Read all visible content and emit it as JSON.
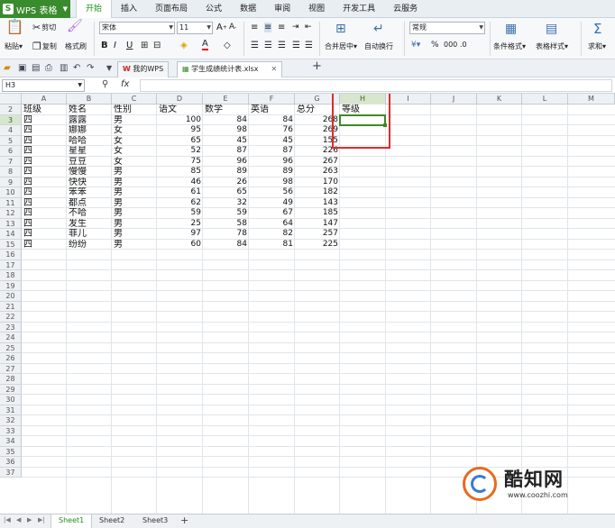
{
  "menubar": {
    "app_name": "WPS 表格",
    "tabs": [
      "开始",
      "插入",
      "页面布局",
      "公式",
      "数据",
      "审阅",
      "视图",
      "开发工具",
      "云服务"
    ],
    "active_tab": 0
  },
  "ribbon": {
    "paste": "粘贴",
    "cut": "剪切",
    "copy": "复制",
    "format_painter": "格式刷",
    "font": "宋体",
    "font_size": "11",
    "bold": "B",
    "italic": "I",
    "underline": "U",
    "merge_center": "合并居中",
    "wrap": "自动换行",
    "number_format": "常规",
    "cond_format": "条件格式",
    "table_style": "表格样式",
    "sum": "求和"
  },
  "doc_tabs": [
    {
      "label": "我的WPS"
    },
    {
      "label": "学生成绩统计表.xlsx"
    }
  ],
  "formula_bar": {
    "name_box": "H3",
    "fx_label": "fx",
    "value": ""
  },
  "columns": [
    "A",
    "B",
    "C",
    "D",
    "E",
    "F",
    "G",
    "H",
    "I",
    "J",
    "K",
    "L",
    "M"
  ],
  "selected_column": "H",
  "selected_row": 3,
  "rows": [
    {
      "n": 2,
      "cells": [
        "班级",
        "姓名",
        "性别",
        "语文",
        "数学",
        "英语",
        "总分",
        "等级"
      ]
    },
    {
      "n": 3,
      "cells": [
        "四",
        "露露",
        "男",
        "100",
        "84",
        "84",
        "268",
        ""
      ]
    },
    {
      "n": 4,
      "cells": [
        "四",
        "娜娜",
        "女",
        "95",
        "98",
        "76",
        "269",
        ""
      ]
    },
    {
      "n": 5,
      "cells": [
        "四",
        "哈哈",
        "女",
        "65",
        "45",
        "45",
        "155",
        ""
      ]
    },
    {
      "n": 6,
      "cells": [
        "四",
        "星星",
        "女",
        "52",
        "87",
        "87",
        "226",
        ""
      ]
    },
    {
      "n": 7,
      "cells": [
        "四",
        "豆豆",
        "女",
        "75",
        "96",
        "96",
        "267",
        ""
      ]
    },
    {
      "n": 8,
      "cells": [
        "四",
        "慢慢",
        "男",
        "85",
        "89",
        "89",
        "263",
        ""
      ]
    },
    {
      "n": 9,
      "cells": [
        "四",
        "快快",
        "男",
        "46",
        "26",
        "98",
        "170",
        ""
      ]
    },
    {
      "n": 10,
      "cells": [
        "四",
        "笨笨",
        "男",
        "61",
        "65",
        "56",
        "182",
        ""
      ]
    },
    {
      "n": 11,
      "cells": [
        "四",
        "都点",
        "男",
        "62",
        "32",
        "49",
        "143",
        ""
      ]
    },
    {
      "n": 12,
      "cells": [
        "四",
        "不哈",
        "男",
        "59",
        "59",
        "67",
        "185",
        ""
      ]
    },
    {
      "n": 13,
      "cells": [
        "四",
        "发生",
        "男",
        "25",
        "58",
        "64",
        "147",
        ""
      ]
    },
    {
      "n": 14,
      "cells": [
        "四",
        "菲儿",
        "男",
        "97",
        "78",
        "82",
        "257",
        ""
      ]
    },
    {
      "n": 15,
      "cells": [
        "四",
        "纷纷",
        "男",
        "60",
        "84",
        "81",
        "225",
        ""
      ]
    }
  ],
  "empty_rows": [
    16,
    17,
    18,
    19,
    20,
    21,
    22,
    23,
    24,
    25,
    26,
    27,
    28,
    29,
    30,
    31,
    32,
    33,
    34,
    35,
    36,
    37
  ],
  "sheets": [
    "Sheet1",
    "Sheet2",
    "Sheet3"
  ],
  "active_sheet": 0,
  "add_sheet": "+",
  "watermark": {
    "name": "酷知网",
    "url": "www.coozhi.com"
  },
  "colors": {
    "accent": "#3a8b2d",
    "annotation": "#e0292b"
  }
}
